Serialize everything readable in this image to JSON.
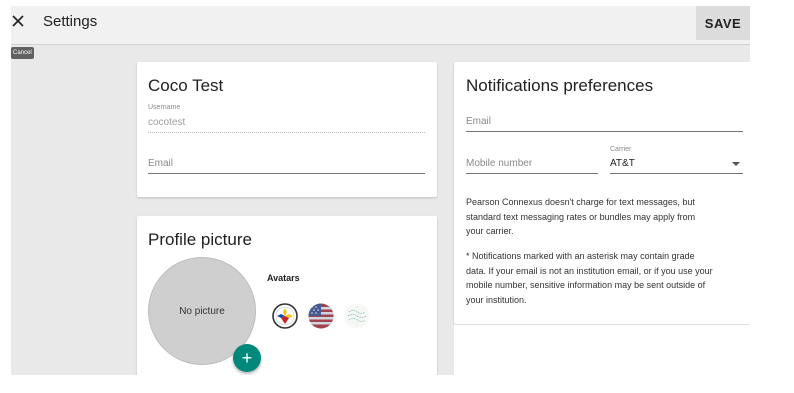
{
  "header": {
    "title": "Settings",
    "save_label": "SAVE",
    "cancel_tooltip": "Cancel"
  },
  "profile": {
    "name": "Coco Test",
    "username_label": "Username",
    "username_value": "cocotest",
    "email_placeholder": "Email"
  },
  "picture": {
    "title": "Profile picture",
    "no_picture": "No picture",
    "avatars_label": "Avatars",
    "avatars": [
      "steelers-avatar",
      "flag-avatar",
      "pattern-avatar"
    ]
  },
  "notifications": {
    "title": "Notifications preferences",
    "email_placeholder": "Email",
    "mobile_placeholder": "Mobile number",
    "carrier_label": "Carrier",
    "carrier_value": "AT&T",
    "note1_lines": [
      "Pearson Connexus doesn't charge for text messages, but",
      "standard text messaging rates or bundles may apply from",
      "your carrier."
    ],
    "note2_lines": [
      "* Notifications marked with an asterisk may contain grade",
      "data. If your email is not an institution email, or if you use your",
      "mobile number, sensitive information may be sent outside of",
      "your institution."
    ]
  },
  "colors": {
    "accent": "#00897b",
    "background": "#e9e9e9"
  }
}
